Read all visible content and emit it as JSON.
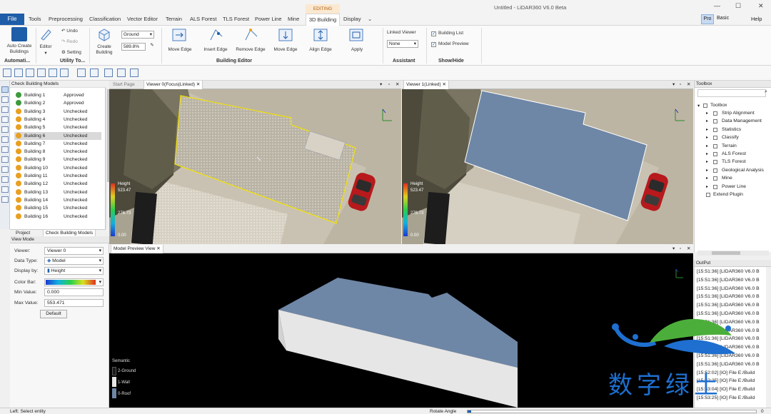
{
  "menu": {
    "file": "File",
    "tabs": [
      "Tools",
      "Preprocessing",
      "Classification",
      "Vector Editor",
      "Terrain",
      "ALS Forest",
      "TLS Forest",
      "Power Line",
      "Mine",
      "3D Building",
      "Display"
    ],
    "context": "EDITING",
    "more": "⌄",
    "title": "Untitled - LiDAR360 V6.0 Beta",
    "pro": "Pro",
    "basic": "Basic",
    "help": "Help"
  },
  "ribbon": {
    "auto_create": [
      "Auto Create",
      "Buildings"
    ],
    "automation_group": "Automati...",
    "editor": "Editor",
    "undo": "Undo",
    "redo": "Redo",
    "setting": "Setting",
    "utility_group": "Utility To...",
    "create_building": [
      "Create",
      "Building"
    ],
    "ground_select": "Ground",
    "height_value": "589.8%",
    "move_edge_1": "Move Edge",
    "insert_edge": "Insert Edge",
    "remove_edge": "Remove Edge",
    "move_edge_2": "Move Edge",
    "align_edge": "Align Edge",
    "apply": "Apply",
    "building_editor_group": "Building Editor",
    "linked_viewer": "Linked Viewer",
    "linked_none": "None",
    "assistant_group": "Assistant",
    "building_list": "Building List",
    "model_preview": "Model Preview",
    "showhide_group": "Show/Hide"
  },
  "list": {
    "title": "Check Building Models",
    "rows": [
      {
        "name": "Building 1",
        "status": "Approved"
      },
      {
        "name": "Building 2",
        "status": "Approved"
      },
      {
        "name": "Building 3",
        "status": "Unchecked"
      },
      {
        "name": "Building 4",
        "status": "Unchecked"
      },
      {
        "name": "Building 5",
        "status": "Unchecked"
      },
      {
        "name": "Building 6",
        "status": "Unchecked"
      },
      {
        "name": "Building 7",
        "status": "Unchecked"
      },
      {
        "name": "Building 8",
        "status": "Unchecked"
      },
      {
        "name": "Building 9",
        "status": "Unchecked"
      },
      {
        "name": "Building 10",
        "status": "Unchecked"
      },
      {
        "name": "Building 11",
        "status": "Unchecked"
      },
      {
        "name": "Building 12",
        "status": "Unchecked"
      },
      {
        "name": "Building 13",
        "status": "Unchecked"
      },
      {
        "name": "Building 14",
        "status": "Unchecked"
      },
      {
        "name": "Building 15",
        "status": "Unchecked"
      },
      {
        "name": "Building 16",
        "status": "Unchecked"
      }
    ],
    "selected": 5,
    "tabs": [
      "Project",
      "Check Building Models"
    ]
  },
  "view_mode": {
    "title": "View Mode",
    "viewer_label": "Viewer:",
    "viewer_value": "Viewer 0",
    "datatype_label": "Data Type:",
    "datatype_value": "Model",
    "display_label": "Display by:",
    "display_value": "Height",
    "colorbar_label": "Color Bar:",
    "min_label": "Min Value:",
    "min_value": "0.000",
    "max_label": "Max Value:",
    "max_value": "553.471",
    "default_btn": "Default"
  },
  "viewer0": {
    "tabs": [
      "Start Page",
      "Viewer 0(Focus|Linked)"
    ],
    "legend_title": "Height",
    "legend_max": "523.47",
    "legend_mid": "276.73",
    "legend_min": "0.00"
  },
  "viewer1": {
    "tab": "Viewer 1(Linked)",
    "legend_title": "Height",
    "legend_max": "523.47",
    "legend_mid": "276.73",
    "legend_min": "0.00"
  },
  "preview": {
    "tab": "Model Preview View",
    "legend_title": "Semantic",
    "legend": [
      "2-Ground",
      "1-Wall",
      "0-Roof"
    ]
  },
  "toolbox": {
    "title": "Toolbox",
    "root": "Toolbox",
    "items": [
      "Strip Alignment",
      "Data Management",
      "Statistics",
      "Classify",
      "Terrain",
      "ALS Forest",
      "TLS Forest",
      "Geological Analysis",
      "Mine",
      "Power Line"
    ],
    "extend": "Extend Plugin"
  },
  "output": {
    "title": "OutPut",
    "lines": [
      "[15:51:36] [LIDAR360 V6.0 B",
      "[15:51:36] [LIDAR360 V6.0 B",
      "[15:51:36] [LIDAR360 V6.0 B",
      "[15:51:36] [LIDAR360 V6.0 B",
      "[15:51:36] [LIDAR360 V6.0 B",
      "[15:51:36] [LIDAR360 V6.0 B",
      "[15:51:36] [LIDAR360 V6.0 B",
      "[15:51:36] [LIDAR360 V6.0 B",
      "[15:51:36] [LIDAR360 V6.0 B",
      "[15:51:36] [LIDAR360 V6.0 B",
      "[15:51:36] [LIDAR360 V6.0 B",
      "[15:51:36] [LIDAR360 V6.0 B",
      "[15:52:02] [IO] File E:/Build",
      "[15:52:25] [IO] File E:/Build",
      "[15:53:04] [IO] File E:/Build",
      "[15:53:25] [IO] File E:/Build"
    ]
  },
  "watermark": "数字绿土",
  "status": {
    "left": "Left: Select entity",
    "rotate": "Rotate Angle",
    "rotate_val": "0"
  },
  "colors": {
    "accent": "#1e5da8",
    "roof": "#6f87a6",
    "wall": "#e6e6e6",
    "approved": "#3c9a3c",
    "unchecked": "#e8a020",
    "selection": "#f2e200"
  }
}
